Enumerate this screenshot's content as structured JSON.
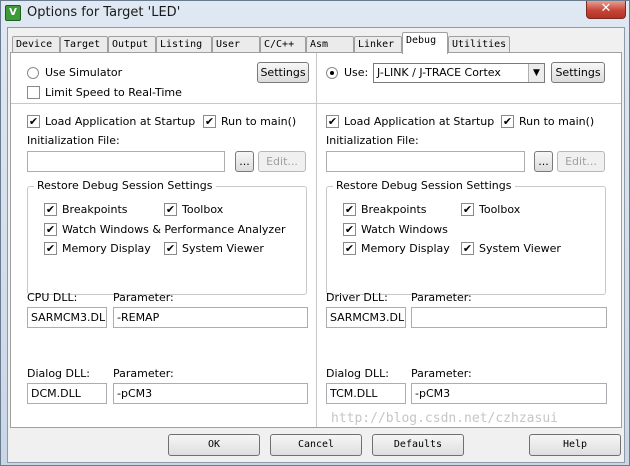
{
  "window": {
    "title": "Options for Target 'LED'",
    "close_glyph": "✕",
    "icon": "uvision-icon"
  },
  "tabs": [
    {
      "label": "Device"
    },
    {
      "label": "Target"
    },
    {
      "label": "Output"
    },
    {
      "label": "Listing"
    },
    {
      "label": "User"
    },
    {
      "label": "C/C++"
    },
    {
      "label": "Asm"
    },
    {
      "label": "Linker"
    },
    {
      "label": "Debug"
    },
    {
      "label": "Utilities"
    }
  ],
  "active_tab": "Debug",
  "left": {
    "use_simulator": "Use Simulator",
    "limit_speed": "Limit Speed to Real-Time",
    "settings": "Settings",
    "load_app": "Load Application at Startup",
    "run_to_main": "Run to main()",
    "init_file_label": "Initialization File:",
    "init_file_value": "",
    "browse": "...",
    "edit": "Edit...",
    "restore_title": "Restore Debug Session Settings",
    "breakpoints": "Breakpoints",
    "toolbox": "Toolbox",
    "watch": "Watch Windows & Performance Analyzer",
    "memory": "Memory Display",
    "system_viewer": "System Viewer",
    "dll_label": "CPU DLL:",
    "dll_param_label": "Parameter:",
    "dll_value": "SARMCM3.DLL",
    "dll_param": "-REMAP",
    "dialog_label": "Dialog DLL:",
    "dialog_param_label": "Parameter:",
    "dialog_value": "DCM.DLL",
    "dialog_param": "-pCM3"
  },
  "right": {
    "use_label": "Use:",
    "driver": "J-LINK / J-TRACE Cortex",
    "settings": "Settings",
    "load_app": "Load Application at Startup",
    "run_to_main": "Run to main()",
    "init_file_label": "Initialization File:",
    "init_file_value": "",
    "browse": "...",
    "edit": "Edit...",
    "restore_title": "Restore Debug Session Settings",
    "breakpoints": "Breakpoints",
    "toolbox": "Toolbox",
    "watch": "Watch Windows",
    "memory": "Memory Display",
    "system_viewer": "System Viewer",
    "dll_label": "Driver DLL:",
    "dll_param_label": "Parameter:",
    "dll_value": "SARMCM3.DLL",
    "dll_param": "",
    "dialog_label": "Dialog DLL:",
    "dialog_param_label": "Parameter:",
    "dialog_value": "TCM.DLL",
    "dialog_param": "-pCM3"
  },
  "check_glyph": "✔",
  "combo_arrow": "▼",
  "footer": {
    "ok": "OK",
    "cancel": "Cancel",
    "defaults": "Defaults",
    "help": "Help"
  },
  "watermark": "http://blog.csdn.net/czhzasui"
}
